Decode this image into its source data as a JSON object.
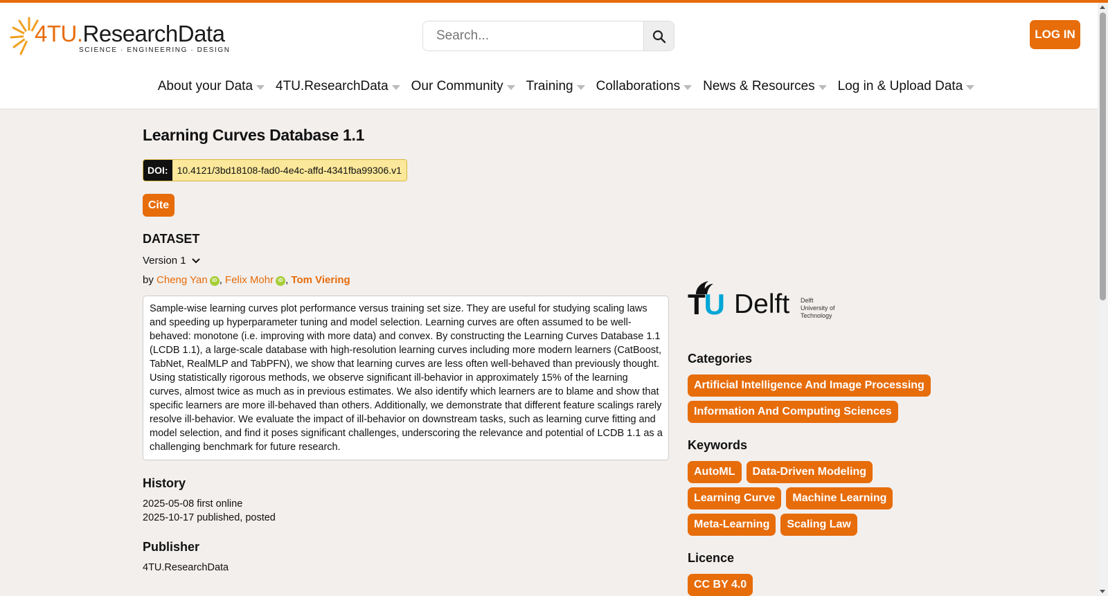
{
  "brand": {
    "name_part1": "4TU.",
    "name_part2": "ResearchData",
    "tagline": "SCIENCE · ENGINEERING · DESIGN",
    "accent": "#e76c0a"
  },
  "search": {
    "placeholder": "Search..."
  },
  "header": {
    "login_label": "LOG IN"
  },
  "nav": {
    "items": [
      "About your Data",
      "4TU.ResearchData",
      "Our Community",
      "Training",
      "Collaborations",
      "News & Resources",
      "Log in & Upload Data"
    ]
  },
  "dataset": {
    "title": "Learning Curves Database 1.1",
    "doi_label": "DOI:",
    "doi": "10.4121/3bd18108-fad0-4e4c-affd-4341fba99306.v1",
    "cite_label": "Cite",
    "type": "DATASET",
    "version": "Version 1",
    "by": "by",
    "authors": [
      "Cheng Yan",
      "Felix Mohr",
      "Tom Viering"
    ],
    "abstract": "Sample-wise learning curves plot performance versus training set size. They are useful for studying scaling laws and speeding up hyperparameter tuning and model selection. Learning curves are often assumed to be well-behaved: monotone (i.e. improving with more data) and convex. By constructing the Learning Curves Database 1.1 (LCDB 1.1), a large-scale database with high-resolution learning curves including more modern learners (CatBoost, TabNet, RealMLP and TabPFN), we show that learning curves are less often well-behaved than previously thought. Using statistically rigorous methods, we observe significant ill-behavior in approximately 15% of the learning curves, almost twice as much as in previous estimates. We also identify which learners are to blame and show that specific learners are more ill-behaved than others. Additionally, we demonstrate that different feature scalings rarely resolve ill-behavior. We evaluate the impact of ill-behavior on downstream tasks, such as learning curve fitting and model selection, and find it poses significant challenges, underscoring the relevance and potential of LCDB 1.1 as a challenging benchmark for future research.",
    "history_heading": "History",
    "history": [
      "2025-05-08 first online",
      "2025-10-17 published, posted"
    ],
    "publisher_heading": "Publisher",
    "publisher": "4TU.ResearchData"
  },
  "sidebar": {
    "institution": {
      "tu": "T",
      "u": "U",
      "delft": "Delft",
      "small": [
        "Delft",
        "University of",
        "Technology"
      ]
    },
    "categories_heading": "Categories",
    "categories": [
      "Artificial Intelligence And Image Processing",
      "Information And Computing Sciences"
    ],
    "keywords_heading": "Keywords",
    "keywords": [
      "AutoML",
      "Data-Driven Modeling",
      "Learning Curve",
      "Machine Learning",
      "Meta-Learning",
      "Scaling Law"
    ],
    "licence_heading": "Licence",
    "licence": "CC BY 4.0"
  }
}
